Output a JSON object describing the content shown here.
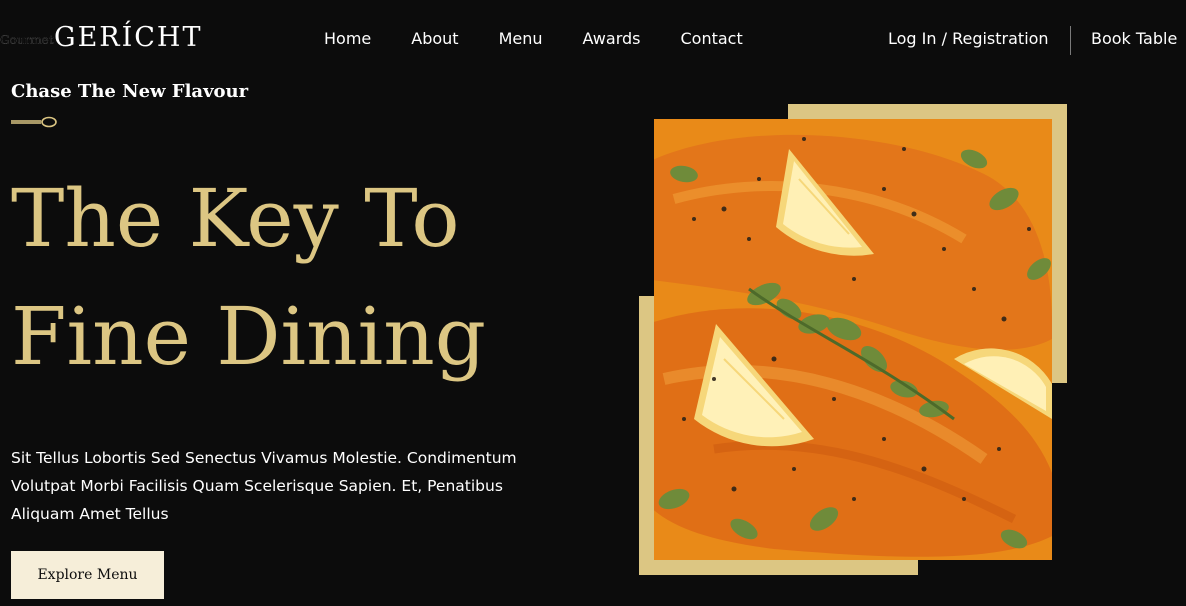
{
  "brand": {
    "logo": "GERÍCHT",
    "logo_fallback_text": "Gourmet"
  },
  "nav": {
    "links": [
      {
        "label": "Home"
      },
      {
        "label": "About"
      },
      {
        "label": "Menu"
      },
      {
        "label": "Awards"
      },
      {
        "label": "Contact"
      }
    ],
    "auth_label": "Log In / Registration",
    "book_label": "Book Table"
  },
  "hero": {
    "tagline": "Chase The New Flavour",
    "headline_line1": "The Key To",
    "headline_line2": "Fine Dining",
    "description": "Sit Tellus Lobortis Sed Senectus Vivamus Molestie. Condimentum Volutpat Morbi Facilisis Quam Scelerisque Sapien. Et, Penatibus Aliquam Amet Tellus",
    "cta_label": "Explore Menu"
  },
  "colors": {
    "background": "#0c0c0c",
    "gold": "#dcc683",
    "cream": "#f6eed9",
    "text": "#ffffff"
  },
  "icons": {
    "spoon": "spoon-divider-icon"
  }
}
